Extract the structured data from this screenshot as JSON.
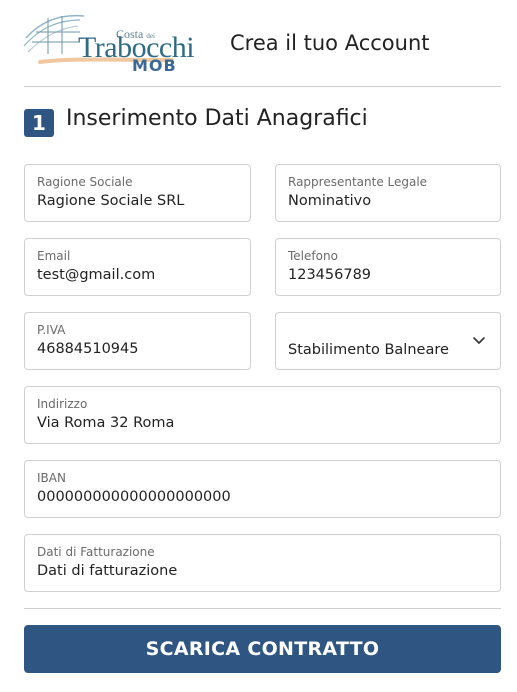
{
  "header": {
    "logo": {
      "costa": "Costa",
      "costa_small": "dei",
      "trabocchi": "Trabocchi",
      "mob": "MOB"
    },
    "title": "Crea il tuo Account"
  },
  "section": {
    "step": "1",
    "title": "Inserimento Dati Anagrafici"
  },
  "fields": {
    "ragione_sociale": {
      "label": "Ragione Sociale",
      "value": "Ragione Sociale SRL"
    },
    "rappresentante": {
      "label": "Rappresentante Legale",
      "value": "Nominativo"
    },
    "email": {
      "label": "Email",
      "value": "test@gmail.com"
    },
    "telefono": {
      "label": "Telefono",
      "value": "123456789"
    },
    "piva": {
      "label": "P.IVA",
      "value": "46884510945"
    },
    "tipo": {
      "value": "Stabilimento Balneare"
    },
    "indirizzo": {
      "label": "Indirizzo",
      "value": "Via Roma 32 Roma"
    },
    "iban": {
      "label": "IBAN",
      "value": "000000000000000000000"
    },
    "fatturazione": {
      "label": "Dati di Fatturazione",
      "value": "Dati di fatturazione"
    }
  },
  "actions": {
    "download_label": "SCARICA CONTRATTO"
  },
  "colors": {
    "primary": "#2f5683",
    "logo_blue": "#2f6b86",
    "border": "#d0d0d0"
  },
  "icons": {
    "select_chevron": "chevron-down-icon"
  }
}
